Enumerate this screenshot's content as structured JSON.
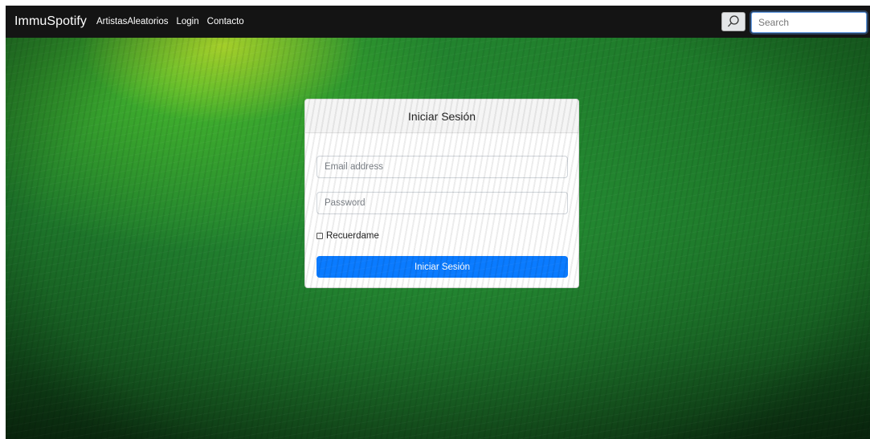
{
  "navbar": {
    "brand": "ImmuSpotify",
    "links": [
      "ArtistasAleatorios",
      "Login",
      "Contacto"
    ],
    "search": {
      "placeholder": "Search",
      "value": ""
    }
  },
  "login_card": {
    "title": "Iniciar Sesión",
    "email": {
      "placeholder": "Email address",
      "value": ""
    },
    "password": {
      "placeholder": "Password",
      "value": ""
    },
    "remember_label": "Recuerdame",
    "remember_checked": false,
    "submit_label": "Iniciar Sesión"
  },
  "colors": {
    "navbar_bg": "#141414",
    "primary_button": "#0a7bff",
    "background": "green textured"
  },
  "icons": {
    "search_button": "search-icon"
  }
}
